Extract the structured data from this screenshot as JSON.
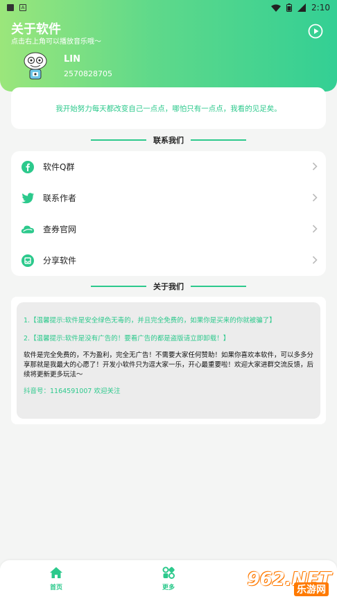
{
  "status_bar": {
    "time": "2:10"
  },
  "header": {
    "title": "关于软件",
    "subtitle": "点击右上角可以播放音乐哦～",
    "name": "LIN",
    "qq": "2570828705",
    "play_icon": "play-circle-icon"
  },
  "quote": "我开始努力每天都改变自己一点点，哪怕只有一点点，我看的见足矣。",
  "contact_section": {
    "title": "联系我们"
  },
  "contacts": [
    {
      "label": "软件Q群",
      "icon": "facebook-icon"
    },
    {
      "label": "联系作者",
      "icon": "twitter-icon"
    },
    {
      "label": "查券官网",
      "icon": "cloud-icon"
    },
    {
      "label": "分享软件",
      "icon": "inbox-icon"
    }
  ],
  "about_section": {
    "title": "关于我们"
  },
  "about": {
    "line1": "1.【温馨提示:软件是安全绿色无毒的，并且完全免费的，如果你是买来的你就被骗了】",
    "line2": "2.【温馨提示:软件是没有广告的！要看广告的都是盗版请立即卸载！】",
    "body": "软件是完全免费的，不为盈利，完全无广告！不需要大家任何赞助！如果你喜欢本软件，可以多多分享那就是我最大的心愿了！开发小软件只为逗大家一乐，开心最重要啦！欢迎大家进群交流反馈，后续将更新更多玩法～",
    "douyin": "抖音号：1164591007 欢迎关注"
  },
  "bottom_nav": [
    {
      "label": "首页",
      "icon": "home-icon"
    },
    {
      "label": "更多",
      "icon": "more-icon"
    }
  ],
  "watermark": {
    "logo": "962.NET",
    "text": "乐游网"
  },
  "colors": {
    "accent": "#2cc98c",
    "header_start": "#9be67b",
    "header_end": "#33cf94"
  }
}
